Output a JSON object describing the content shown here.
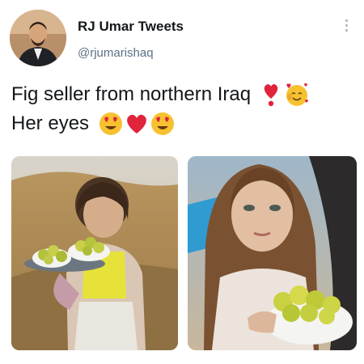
{
  "tweet": {
    "author_name": "RJ Umar Tweets",
    "author_handle": "@rjumarishaq",
    "text_line1": "Fig seller from northern Iraq",
    "text_line2": "Her eyes"
  },
  "icons": {
    "more": "more-options-icon",
    "line1_emojis": [
      "exclamation-heart-icon",
      "smiling-face-with-hearts-icon"
    ],
    "line2_emojis": [
      "heart-eyes-icon",
      "red-heart-icon",
      "heart-eyes-icon"
    ]
  },
  "colors": {
    "handle_gray": "#5b7083",
    "heart_red": "#e0243c",
    "emoji_yellow": "#f7c230"
  }
}
